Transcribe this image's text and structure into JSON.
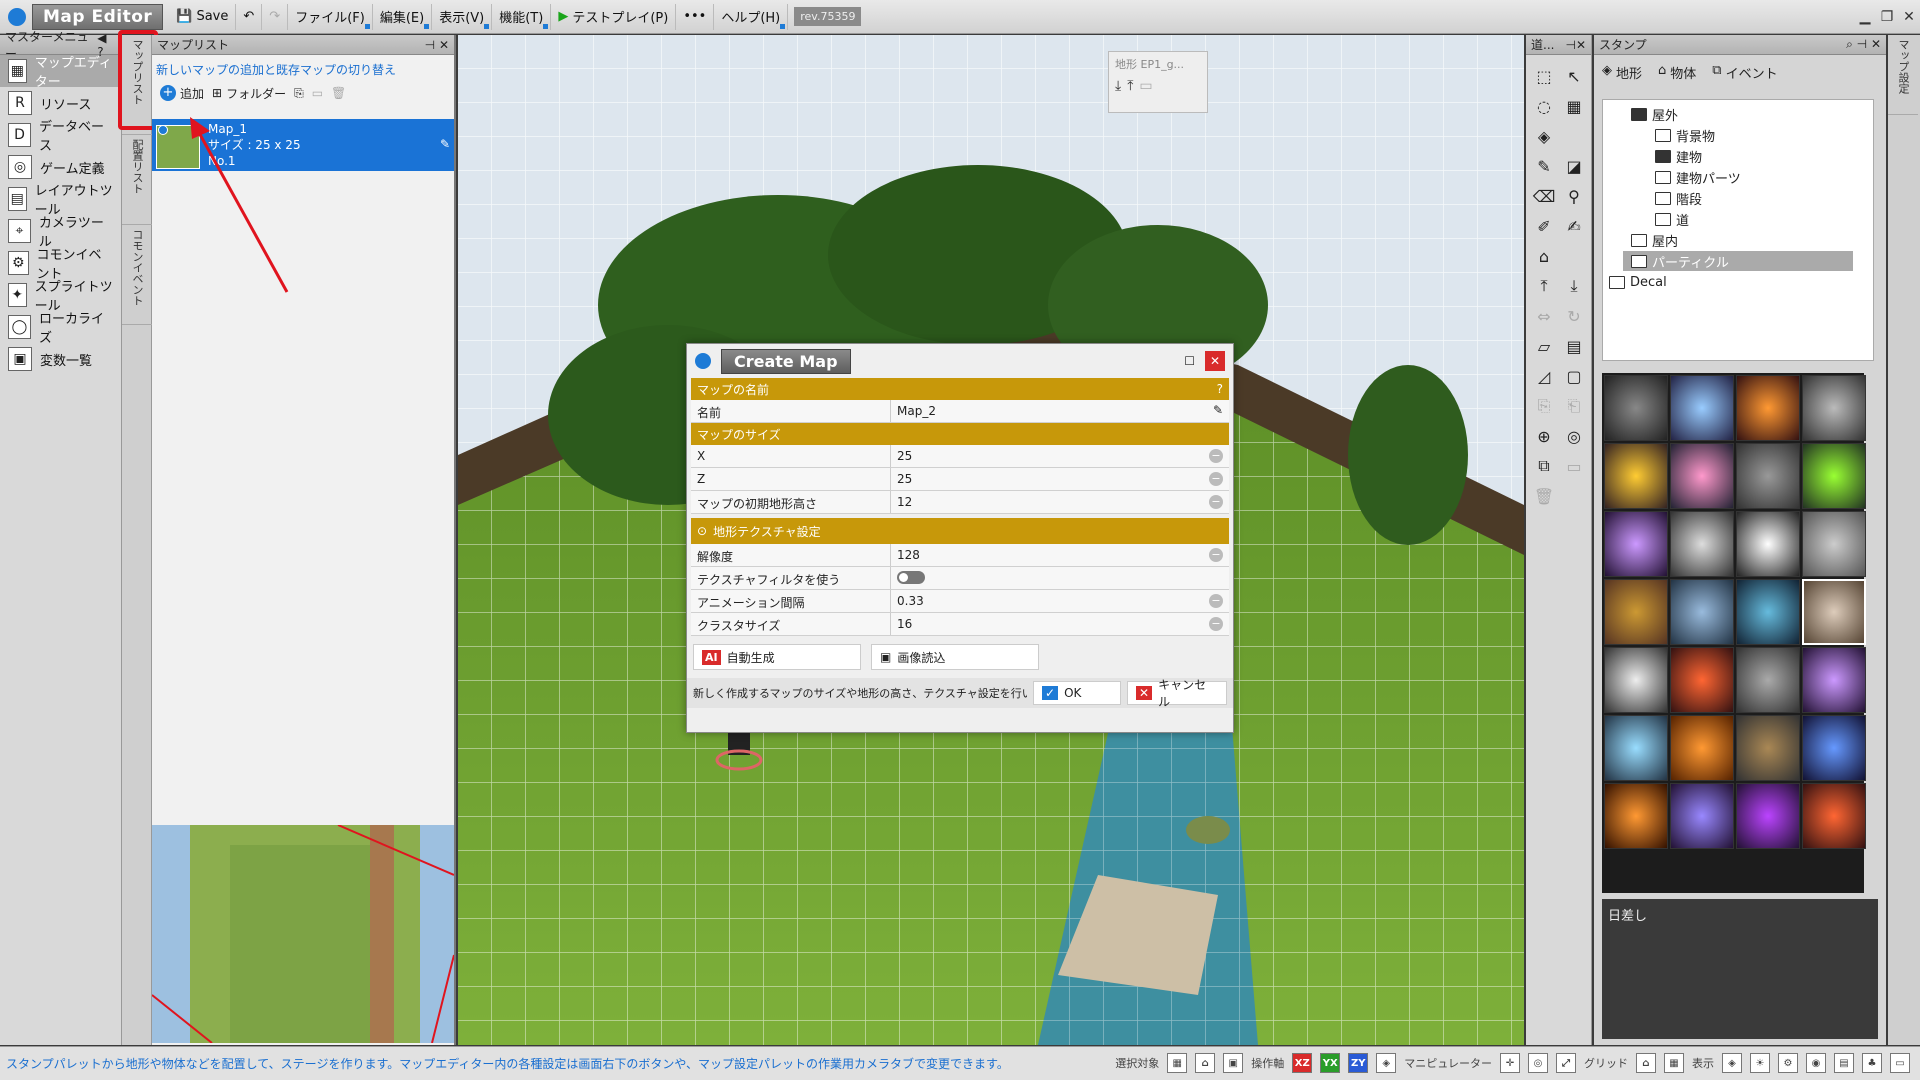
{
  "app": {
    "title": "Map Editor",
    "save_label": "Save",
    "revision": "rev.75359"
  },
  "menubar": [
    "ファイル(F)",
    "編集(E)",
    "表示(V)",
    "機能(T)"
  ],
  "testplay_label": "テストプレイ(P)",
  "help_label": "ヘルプ(H)",
  "master_menu": {
    "title": "マスターメニュー",
    "items": [
      "マップエディター",
      "リソース",
      "データベース",
      "ゲーム定義",
      "レイアウトツール",
      "カメラツール",
      "コモンイベント",
      "スプライトツール",
      "ローカライズ",
      "変数一覧"
    ]
  },
  "vtabs": [
    "マップリスト",
    "配置リスト",
    "コモンイベント"
  ],
  "maplist": {
    "title": "マップリスト",
    "description": "新しいマップの追加と既存マップの切り替え",
    "add_label": "追加",
    "folder_label": "フォルダー",
    "map_name": "Map_1",
    "map_size": "サイズ : 25 x 25",
    "map_no": "No.1"
  },
  "viewport": {
    "overlay_label": "地形 EP1_g..."
  },
  "dialog": {
    "title": "Create Map",
    "sections": {
      "name": "マップの名前",
      "size": "マップのサイズ",
      "texture": "地形テクスチャ設定"
    },
    "help_mark": "?",
    "rows": {
      "name": {
        "k": "名前",
        "v": "Map_2"
      },
      "x": {
        "k": "X",
        "v": "25"
      },
      "z": {
        "k": "Z",
        "v": "25"
      },
      "height": {
        "k": "マップの初期地形高さ",
        "v": "12"
      },
      "res": {
        "k": "解像度",
        "v": "128"
      },
      "filter": {
        "k": "テクスチャフィルタを使う"
      },
      "anim": {
        "k": "アニメーション間隔",
        "v": "0.33"
      },
      "cluster": {
        "k": "クラスタサイズ",
        "v": "16"
      }
    },
    "auto_gen": "自動生成",
    "ai_badge": "AI",
    "img_load": "画像読込",
    "footer_text": "新しく作成するマップのサイズや地形の高さ、テクスチャ設定を行い",
    "ok": "OK",
    "cancel": "キャンセル"
  },
  "tools_title": "道...",
  "stamp": {
    "title": "スタンプ",
    "tabs": [
      "地形",
      "物体",
      "イベント"
    ],
    "tree": [
      [
        "屋外",
        0
      ],
      [
        "背景物",
        1
      ],
      [
        "建物",
        1
      ],
      [
        "建物パーツ",
        1
      ],
      [
        "階段",
        1
      ],
      [
        "道",
        1
      ],
      [
        "屋内",
        0
      ],
      [
        "パーティクル",
        0
      ],
      [
        "Decal",
        -1
      ]
    ],
    "selected_label": "日差し"
  },
  "rstrip_label": "マップ設定",
  "status": {
    "text": "スタンプパレットから地形や物体などを配置して、ステージを作ります。マップエディター内の各種設定は画面右下のボタンや、マップ設定パレットの作業用カメラタブで変更できます。",
    "labels": [
      "選択対象",
      "操作軸",
      "マニピュレーター",
      "グリッド",
      "表示"
    ],
    "axes": [
      "XZ",
      "YX",
      "ZY"
    ]
  }
}
